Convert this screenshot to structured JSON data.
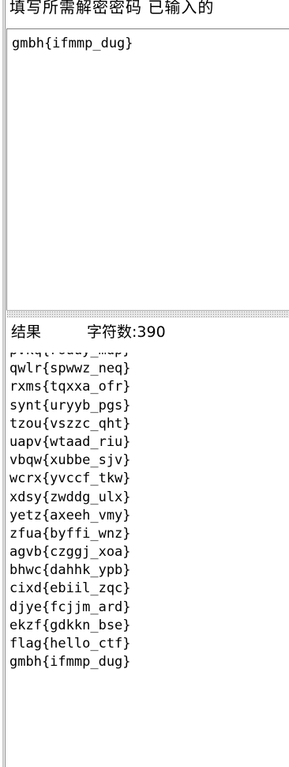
{
  "top_partial_text": "填写所需解密密码    已输入的",
  "input": {
    "text": "gmbh{ifmmp_dug}"
  },
  "result": {
    "label": "结果",
    "count_text": "字符数:390",
    "lines": [
      "pvkq{rouuy_mdp}",
      "qwlr{spwwz_neq}",
      "rxms{tqxxa_ofr}",
      "synt{uryyb_pgs}",
      "tzou{vszzc_qht}",
      "uapv{wtaad_riu}",
      "vbqw{xubbe_sjv}",
      "wcrx{yvccf_tkw}",
      "xdsy{zwddg_ulx}",
      "yetz{axeeh_vmy}",
      "zfua{byffi_wnz}",
      "agvb{czggj_xoa}",
      "bhwc{dahhk_ypb}",
      "cixd{ebiil_zqc}",
      "djye{fcjjm_ard}",
      "ekzf{gdkkn_bse}",
      "flag{hello_ctf}",
      "gmbh{ifmmp_dug}"
    ]
  }
}
